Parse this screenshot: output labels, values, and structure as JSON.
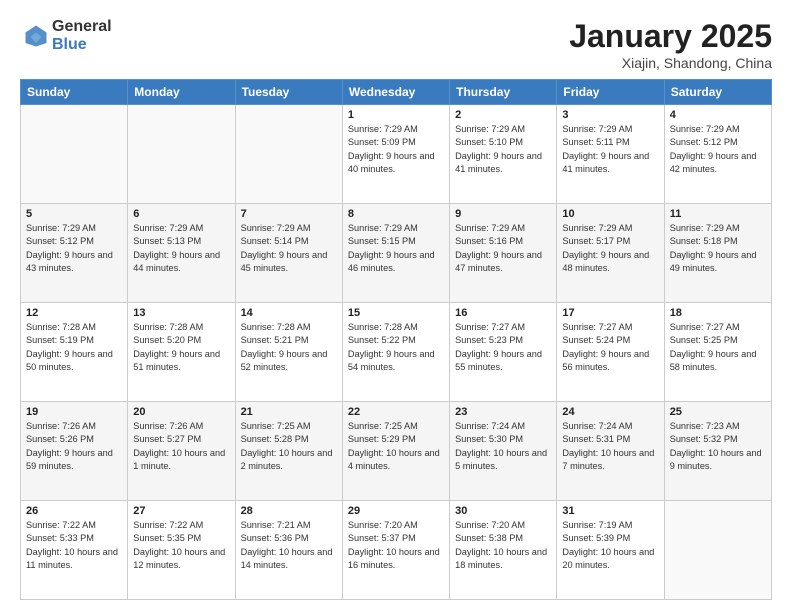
{
  "header": {
    "logo_general": "General",
    "logo_blue": "Blue",
    "title": "January 2025",
    "location": "Xiajin, Shandong, China"
  },
  "weekdays": [
    "Sunday",
    "Monday",
    "Tuesday",
    "Wednesday",
    "Thursday",
    "Friday",
    "Saturday"
  ],
  "weeks": [
    [
      {
        "day": "",
        "info": ""
      },
      {
        "day": "",
        "info": ""
      },
      {
        "day": "",
        "info": ""
      },
      {
        "day": "1",
        "info": "Sunrise: 7:29 AM\nSunset: 5:09 PM\nDaylight: 9 hours\nand 40 minutes."
      },
      {
        "day": "2",
        "info": "Sunrise: 7:29 AM\nSunset: 5:10 PM\nDaylight: 9 hours\nand 41 minutes."
      },
      {
        "day": "3",
        "info": "Sunrise: 7:29 AM\nSunset: 5:11 PM\nDaylight: 9 hours\nand 41 minutes."
      },
      {
        "day": "4",
        "info": "Sunrise: 7:29 AM\nSunset: 5:12 PM\nDaylight: 9 hours\nand 42 minutes."
      }
    ],
    [
      {
        "day": "5",
        "info": "Sunrise: 7:29 AM\nSunset: 5:12 PM\nDaylight: 9 hours\nand 43 minutes."
      },
      {
        "day": "6",
        "info": "Sunrise: 7:29 AM\nSunset: 5:13 PM\nDaylight: 9 hours\nand 44 minutes."
      },
      {
        "day": "7",
        "info": "Sunrise: 7:29 AM\nSunset: 5:14 PM\nDaylight: 9 hours\nand 45 minutes."
      },
      {
        "day": "8",
        "info": "Sunrise: 7:29 AM\nSunset: 5:15 PM\nDaylight: 9 hours\nand 46 minutes."
      },
      {
        "day": "9",
        "info": "Sunrise: 7:29 AM\nSunset: 5:16 PM\nDaylight: 9 hours\nand 47 minutes."
      },
      {
        "day": "10",
        "info": "Sunrise: 7:29 AM\nSunset: 5:17 PM\nDaylight: 9 hours\nand 48 minutes."
      },
      {
        "day": "11",
        "info": "Sunrise: 7:29 AM\nSunset: 5:18 PM\nDaylight: 9 hours\nand 49 minutes."
      }
    ],
    [
      {
        "day": "12",
        "info": "Sunrise: 7:28 AM\nSunset: 5:19 PM\nDaylight: 9 hours\nand 50 minutes."
      },
      {
        "day": "13",
        "info": "Sunrise: 7:28 AM\nSunset: 5:20 PM\nDaylight: 9 hours\nand 51 minutes."
      },
      {
        "day": "14",
        "info": "Sunrise: 7:28 AM\nSunset: 5:21 PM\nDaylight: 9 hours\nand 52 minutes."
      },
      {
        "day": "15",
        "info": "Sunrise: 7:28 AM\nSunset: 5:22 PM\nDaylight: 9 hours\nand 54 minutes."
      },
      {
        "day": "16",
        "info": "Sunrise: 7:27 AM\nSunset: 5:23 PM\nDaylight: 9 hours\nand 55 minutes."
      },
      {
        "day": "17",
        "info": "Sunrise: 7:27 AM\nSunset: 5:24 PM\nDaylight: 9 hours\nand 56 minutes."
      },
      {
        "day": "18",
        "info": "Sunrise: 7:27 AM\nSunset: 5:25 PM\nDaylight: 9 hours\nand 58 minutes."
      }
    ],
    [
      {
        "day": "19",
        "info": "Sunrise: 7:26 AM\nSunset: 5:26 PM\nDaylight: 9 hours\nand 59 minutes."
      },
      {
        "day": "20",
        "info": "Sunrise: 7:26 AM\nSunset: 5:27 PM\nDaylight: 10 hours\nand 1 minute."
      },
      {
        "day": "21",
        "info": "Sunrise: 7:25 AM\nSunset: 5:28 PM\nDaylight: 10 hours\nand 2 minutes."
      },
      {
        "day": "22",
        "info": "Sunrise: 7:25 AM\nSunset: 5:29 PM\nDaylight: 10 hours\nand 4 minutes."
      },
      {
        "day": "23",
        "info": "Sunrise: 7:24 AM\nSunset: 5:30 PM\nDaylight: 10 hours\nand 5 minutes."
      },
      {
        "day": "24",
        "info": "Sunrise: 7:24 AM\nSunset: 5:31 PM\nDaylight: 10 hours\nand 7 minutes."
      },
      {
        "day": "25",
        "info": "Sunrise: 7:23 AM\nSunset: 5:32 PM\nDaylight: 10 hours\nand 9 minutes."
      }
    ],
    [
      {
        "day": "26",
        "info": "Sunrise: 7:22 AM\nSunset: 5:33 PM\nDaylight: 10 hours\nand 11 minutes."
      },
      {
        "day": "27",
        "info": "Sunrise: 7:22 AM\nSunset: 5:35 PM\nDaylight: 10 hours\nand 12 minutes."
      },
      {
        "day": "28",
        "info": "Sunrise: 7:21 AM\nSunset: 5:36 PM\nDaylight: 10 hours\nand 14 minutes."
      },
      {
        "day": "29",
        "info": "Sunrise: 7:20 AM\nSunset: 5:37 PM\nDaylight: 10 hours\nand 16 minutes."
      },
      {
        "day": "30",
        "info": "Sunrise: 7:20 AM\nSunset: 5:38 PM\nDaylight: 10 hours\nand 18 minutes."
      },
      {
        "day": "31",
        "info": "Sunrise: 7:19 AM\nSunset: 5:39 PM\nDaylight: 10 hours\nand 20 minutes."
      },
      {
        "day": "",
        "info": ""
      }
    ]
  ]
}
